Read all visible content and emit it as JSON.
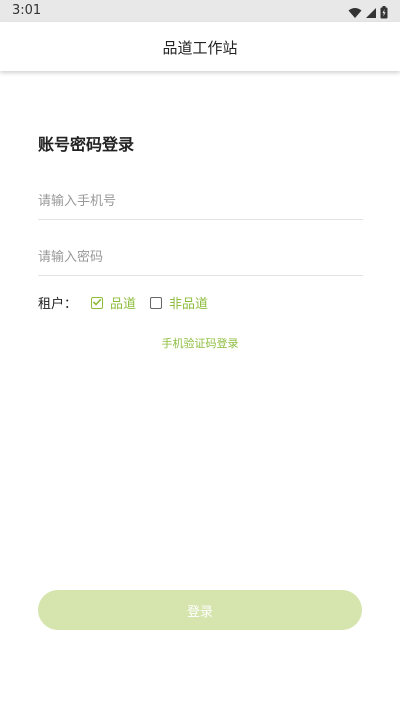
{
  "status_bar": {
    "time": "3:01",
    "icons": [
      "wifi-icon",
      "signal-icon",
      "battery-icon"
    ]
  },
  "app_bar": {
    "title": "品道工作站"
  },
  "login": {
    "title": "账号密码登录",
    "phone_placeholder": "请输入手机号",
    "phone_value": "",
    "password_placeholder": "请输入密码",
    "password_value": "",
    "tenant_label": "租户：",
    "tenant_options": [
      {
        "label": "品道",
        "checked": true
      },
      {
        "label": "非品道",
        "checked": false
      }
    ],
    "sms_login_link": "手机验证码登录",
    "submit_label": "登录"
  },
  "colors": {
    "accent": "#8dbd3e",
    "button_disabled": "#d6e4ae",
    "status_bar_bg": "#e8e8e8"
  }
}
